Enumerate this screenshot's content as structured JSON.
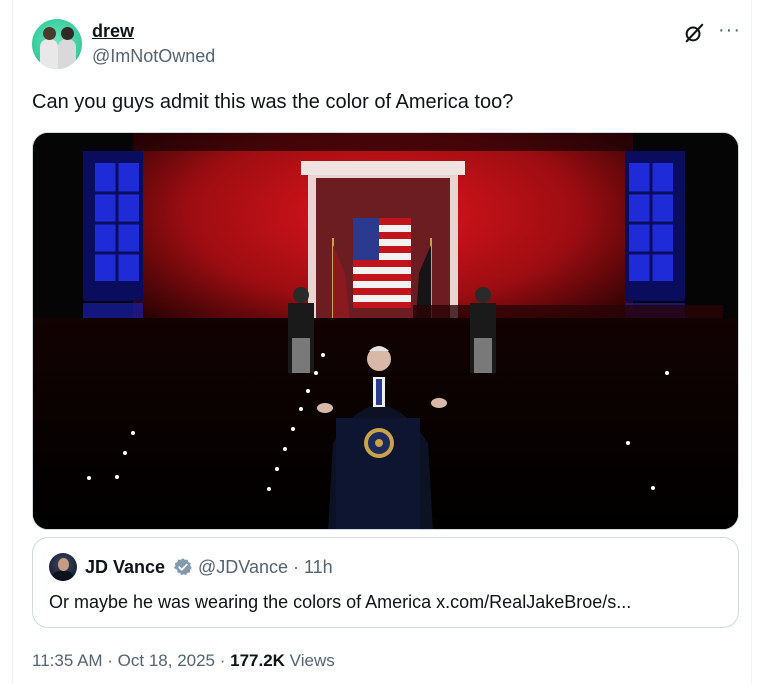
{
  "author": {
    "display_name": "drew",
    "handle": "@ImNotOwned",
    "avatar_icon": "avatar-two-figures"
  },
  "header": {
    "grok_icon": "grok-icon",
    "more_icon": "more-options-icon",
    "more_glyph": "···"
  },
  "tweet": {
    "text": "Can you guys admit this was the color of America too?"
  },
  "media": {
    "description_icon": "photo-speech-at-night",
    "colors": {
      "red_wall": "#c8131a",
      "blue_light": "#1e2bd6",
      "background": "#050505"
    }
  },
  "quote": {
    "name": "JD Vance",
    "handle_time": "@JDVance · 11h",
    "text": "Or maybe he was wearing the colors of America x.com/RealJakeBroe/s...",
    "verified_color": "#829aab"
  },
  "meta": {
    "time_date": "11:35 AM · Oct 18, 2025 · ",
    "views_count": "177.2K",
    "views_label": " Views"
  }
}
